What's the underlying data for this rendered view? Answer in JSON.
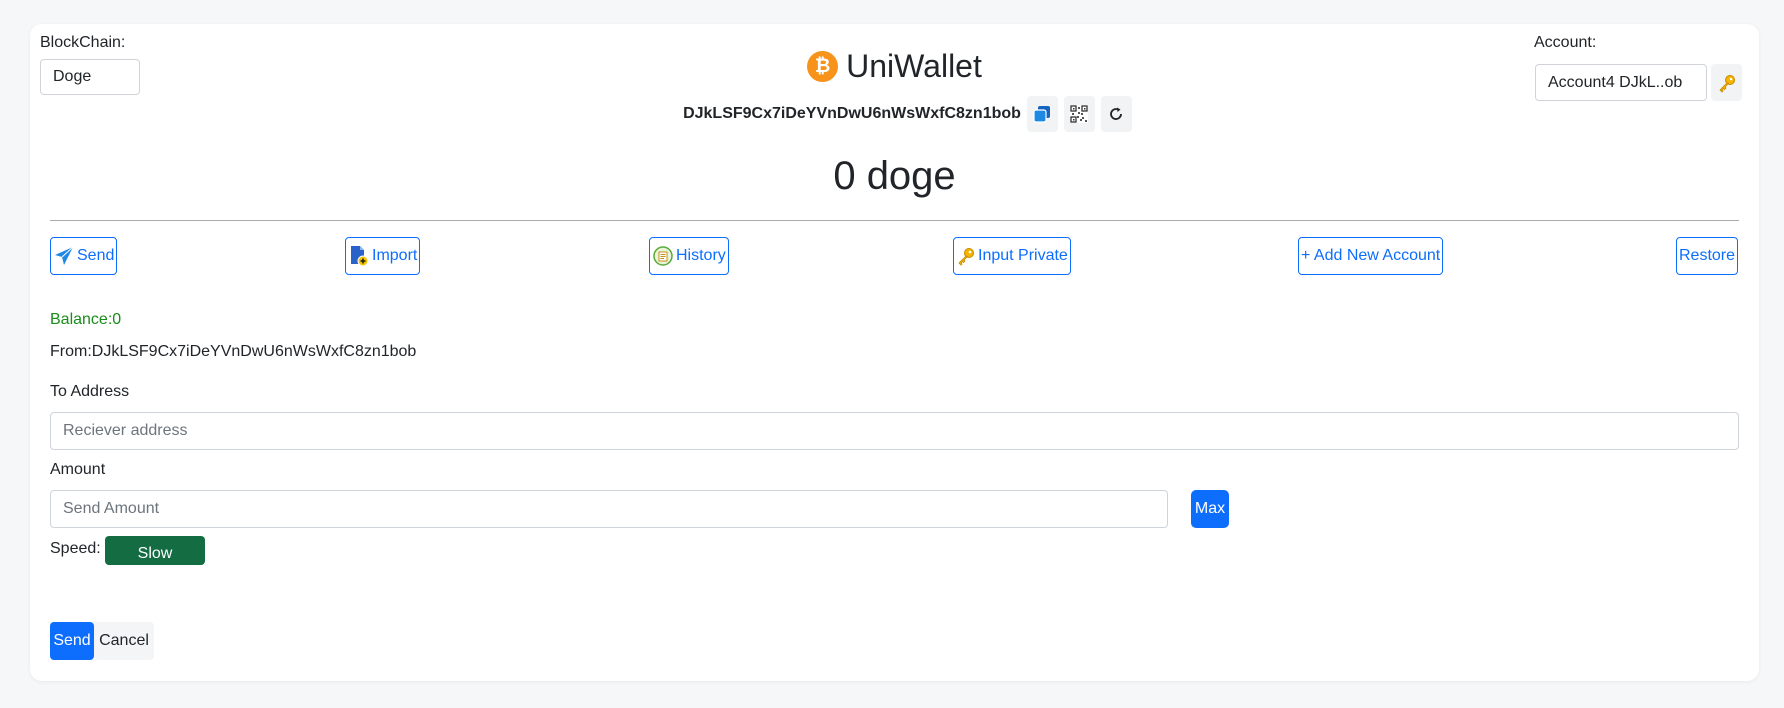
{
  "blockchain": {
    "label": "BlockChain:",
    "selected": "Doge"
  },
  "brand": {
    "title": "UniWallet",
    "logo_glyph": "₿",
    "logo_color": "#f7931a"
  },
  "account": {
    "label": "Account:",
    "selected": "Account4 DJkL..ob",
    "key_icon": "key-icon"
  },
  "wallet": {
    "address": "DJkLSF9Cx7iDeYVnDwU6nWsWxfC8zn1bob",
    "balance_display": "0 doge",
    "icons": [
      "copy-icon",
      "qr-code-icon",
      "refresh-icon"
    ]
  },
  "actions": {
    "send": "Send",
    "import": "Import",
    "history": "History",
    "input_private": "Input Private",
    "add_account": "+ Add New Account",
    "restore": "Restore"
  },
  "send_form": {
    "balance": "Balance:0",
    "from": "From:DJkLSF9Cx7iDeYVnDwU6nWsWxfC8zn1bob",
    "to_label": "To Address",
    "to_placeholder": "Reciever address",
    "amount_label": "Amount",
    "amount_placeholder": "Send Amount",
    "max_label": "Max",
    "speed_label": "Speed:",
    "speed_value": "Slow",
    "send_label": "Send",
    "cancel_label": "Cancel"
  },
  "colors": {
    "primary": "#0d6efd",
    "success_text": "#198c19",
    "speed_button": "#146c43",
    "bitcoin_orange": "#f7931a"
  }
}
